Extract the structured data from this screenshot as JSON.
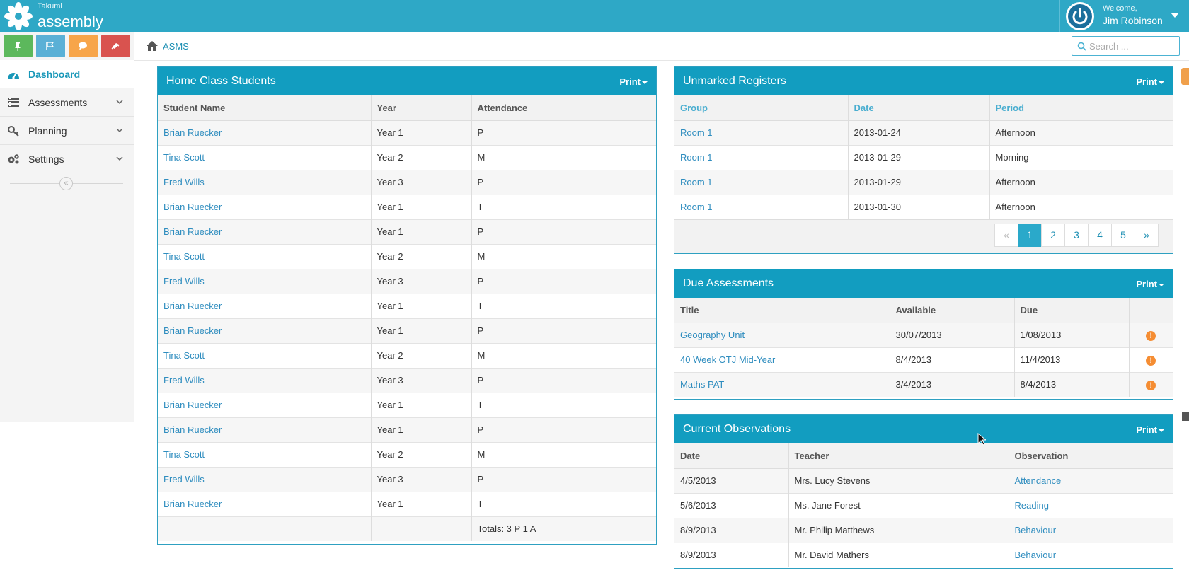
{
  "app": {
    "brand_small": "Takumi",
    "brand_big": "assembly",
    "welcome": "Welcome,",
    "user_name": "Jim Robinson",
    "logo_icon": "snowflake-flower-icon",
    "power_icon": "power-icon",
    "accent_color": "#2ea8c6"
  },
  "shortcuts": [
    {
      "icon": "pin-icon",
      "color": "#5cb85c"
    },
    {
      "icon": "flag-icon",
      "color": "#5ab0d6"
    },
    {
      "icon": "comment-icon",
      "color": "#f7a54a"
    },
    {
      "icon": "book-icon",
      "color": "#d9534f"
    }
  ],
  "sidebar": {
    "items": [
      {
        "label": "Dashboard",
        "icon": "dashboard-icon",
        "active": true
      },
      {
        "label": "Assessments",
        "icon": "list-icon"
      },
      {
        "label": "Planning",
        "icon": "key-icon"
      },
      {
        "label": "Settings",
        "icon": "gears-icon"
      }
    ],
    "collapse_label": "«"
  },
  "breadcrumb": {
    "home_icon": "home-icon",
    "label": "ASMS"
  },
  "search": {
    "placeholder": "Search ..."
  },
  "home_class": {
    "title": "Home Class Students",
    "print": "Print",
    "columns": [
      "Student Name",
      "Year",
      "Attendance"
    ],
    "rows": [
      [
        "Brian Ruecker",
        "Year 1",
        "P"
      ],
      [
        "Tina Scott",
        "Year 2",
        "M"
      ],
      [
        "Fred Wills",
        "Year 3",
        "P"
      ],
      [
        "Brian Ruecker",
        "Year 1",
        "T"
      ],
      [
        "Brian Ruecker",
        "Year 1",
        "P"
      ],
      [
        "Tina Scott",
        "Year 2",
        "M"
      ],
      [
        "Fred Wills",
        "Year 3",
        "P"
      ],
      [
        "Brian Ruecker",
        "Year 1",
        "T"
      ],
      [
        "Brian Ruecker",
        "Year 1",
        "P"
      ],
      [
        "Tina Scott",
        "Year 2",
        "M"
      ],
      [
        "Fred Wills",
        "Year 3",
        "P"
      ],
      [
        "Brian Ruecker",
        "Year 1",
        "T"
      ],
      [
        "Brian Ruecker",
        "Year 1",
        "P"
      ],
      [
        "Tina Scott",
        "Year 2",
        "M"
      ],
      [
        "Fred Wills",
        "Year 3",
        "P"
      ],
      [
        "Brian Ruecker",
        "Year 1",
        "T"
      ]
    ],
    "totals": "Totals: 3 P 1 A"
  },
  "unmarked": {
    "title": "Unmarked Registers",
    "print": "Print",
    "columns": [
      "Group",
      "Date",
      "Period"
    ],
    "rows": [
      [
        "Room 1",
        "2013-01-24",
        "Afternoon"
      ],
      [
        "Room 1",
        "2013-01-29",
        "Morning"
      ],
      [
        "Room 1",
        "2013-01-29",
        "Afternoon"
      ],
      [
        "Room 1",
        "2013-01-30",
        "Afternoon"
      ]
    ],
    "pagination": [
      "«",
      "1",
      "2",
      "3",
      "4",
      "5",
      "»"
    ],
    "current_page": "1"
  },
  "due": {
    "title": "Due Assessments",
    "print": "Print",
    "columns": [
      "Title",
      "Available",
      "Due",
      ""
    ],
    "rows": [
      [
        "Geography Unit",
        "30/07/2013",
        "1/08/2013"
      ],
      [
        "40 Week OTJ Mid-Year",
        "8/4/2013",
        "11/4/2013"
      ],
      [
        "Maths PAT",
        "3/4/2013",
        "8/4/2013"
      ]
    ],
    "alert_icon": "alert-icon",
    "alert_color": "#f58d33"
  },
  "observations": {
    "title": "Current Observations",
    "print": "Print",
    "columns": [
      "Date",
      "Teacher",
      "Observation"
    ],
    "rows": [
      [
        "4/5/2013",
        "Mrs. Lucy Stevens",
        "Attendance"
      ],
      [
        "5/6/2013",
        "Ms. Jane Forest",
        "Reading"
      ],
      [
        "8/9/2013",
        "Mr. Philip Matthews",
        "Behaviour"
      ],
      [
        "8/9/2013",
        "Mr. David Mathers",
        "Behaviour"
      ]
    ]
  }
}
